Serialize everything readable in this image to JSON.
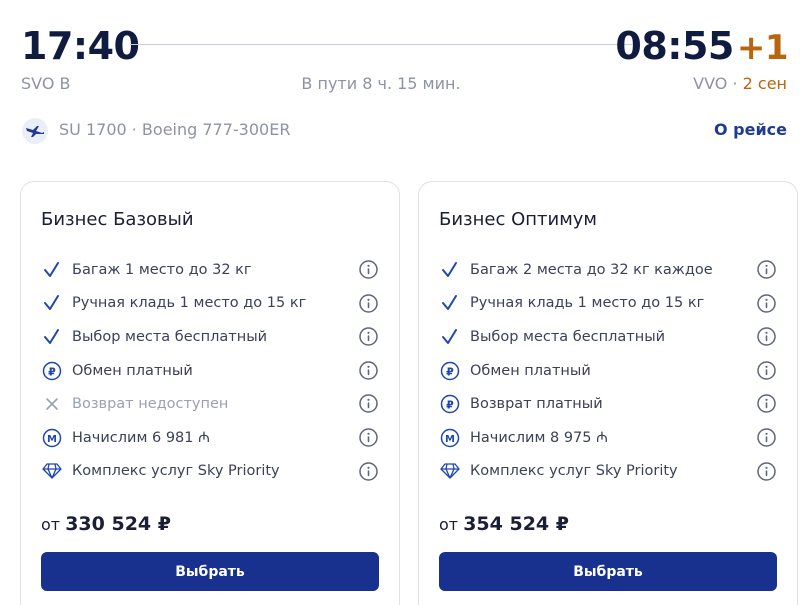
{
  "header": {
    "departure_time": "17:40",
    "arrival_time": "08:55",
    "day_offset": "+1",
    "departure_airport": "SVO B",
    "duration": "В пути 8 ч. 15 мин.",
    "arrival_airport": "VVO",
    "separator": " · ",
    "arrival_date": "2 сен",
    "flight_info": "SU 1700 · Boeing 777-300ER",
    "about_link": "О рейсе"
  },
  "fares": [
    {
      "title": "Бизнес Базовый",
      "features": [
        {
          "icon": "check-icon",
          "label": "Багаж 1 место до 32 кг"
        },
        {
          "icon": "check-icon",
          "label": "Ручная кладь 1 место до 15 кг"
        },
        {
          "icon": "check-icon",
          "label": "Выбор места бесплатный"
        },
        {
          "icon": "ruble-coin-icon",
          "label": "Обмен платный"
        },
        {
          "icon": "cross-icon",
          "label": "Возврат недоступен"
        },
        {
          "icon": "miles-coin-icon",
          "label": "Начислим 6 981 ₼"
        },
        {
          "icon": "diamond-icon",
          "label": "Комплекс услуг Sky Priority"
        }
      ],
      "price_prefix": "от",
      "price": "330 524 ₽",
      "button": "Выбрать"
    },
    {
      "title": "Бизнес Оптимум",
      "features": [
        {
          "icon": "check-icon",
          "label": "Багаж 2 места до 32 кг каждое"
        },
        {
          "icon": "check-icon",
          "label": "Ручная кладь 1 место до 15 кг"
        },
        {
          "icon": "check-icon",
          "label": "Выбор места бесплатный"
        },
        {
          "icon": "ruble-coin-icon",
          "label": "Обмен платный"
        },
        {
          "icon": "ruble-coin-icon",
          "label": "Возврат платный"
        },
        {
          "icon": "miles-coin-icon",
          "label": "Начислим 8 975 ₼"
        },
        {
          "icon": "diamond-icon",
          "label": "Комплекс услуг Sky Priority"
        }
      ],
      "price_prefix": "от",
      "price": "354 524 ₽",
      "button": "Выбрать"
    }
  ],
  "colors": {
    "primary": "#18318f",
    "accent_orange": "#b8650e",
    "muted_text": "#8c93a3",
    "check_blue": "#1f47b3"
  }
}
